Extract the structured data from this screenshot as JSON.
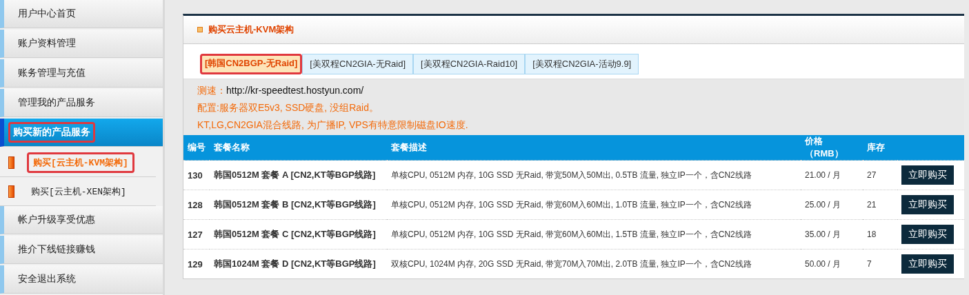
{
  "sidebar": {
    "items": [
      {
        "label": "用户中心首页",
        "selected": false
      },
      {
        "label": "账户资料管理",
        "selected": false
      },
      {
        "label": "账务管理与充值",
        "selected": false
      },
      {
        "label": "管理我的产品服务",
        "selected": false
      },
      {
        "label": "购买新的产品服务",
        "selected": true,
        "children": [
          {
            "label": "购买[云主机-KVM架构]",
            "selected": true
          },
          {
            "label": "购买[云主机-XEN架构]",
            "selected": false
          }
        ]
      },
      {
        "label": "帐户升级享受优惠",
        "selected": false
      },
      {
        "label": "推介下线链接赚钱",
        "selected": false
      },
      {
        "label": "安全退出系统",
        "selected": false
      }
    ]
  },
  "panel": {
    "title": "购买云主机-KVM架构",
    "tabs": [
      {
        "label": "[韩国CN2BGP-无Raid]",
        "selected": true
      },
      {
        "label": "[美双程CN2GIA-无Raid]",
        "selected": false
      },
      {
        "label": "[美双程CN2GIA-Raid10]",
        "selected": false
      },
      {
        "label": "[美双程CN2GIA-活动9.9]",
        "selected": false
      }
    ],
    "speedtest_label": "测速：",
    "speedtest_url": "http://kr-speedtest.hostyun.com/",
    "notes": [
      "配置:服务器双E5v3, SSD硬盘, 没组Raid。",
      "KT,LG,CN2GIA混合线路, 为广播IP, VPS有特意限制磁盘IO速度."
    ],
    "table": {
      "columns": [
        "编号",
        "套餐名称",
        "套餐描述",
        "价格（RMB）",
        "库存"
      ],
      "rows": [
        {
          "id": "130",
          "name": "韩国0512M 套餐 A [CN2,KT等BGP线路]",
          "description": "单核CPU, 0512M 内存, 10G SSD 无Raid, 带宽50M入50M出, 0.5TB 流量, 独立IP一个，含CN2线路",
          "price": "21.00 / 月",
          "stock": "27",
          "action": "立即购买"
        },
        {
          "id": "128",
          "name": "韩国0512M 套餐 B [CN2,KT等BGP线路]",
          "description": "单核CPU, 0512M 内存, 10G SSD 无Raid, 带宽60M入60M出, 1.0TB 流量, 独立IP一个，含CN2线路",
          "price": "25.00 / 月",
          "stock": "21",
          "action": "立即购买"
        },
        {
          "id": "127",
          "name": "韩国0512M 套餐 C [CN2,KT等BGP线路]",
          "description": "单核CPU, 0512M 内存, 10G SSD 无Raid, 带宽60M入60M出, 1.5TB 流量, 独立IP一个，含CN2线路",
          "price": "35.00 / 月",
          "stock": "18",
          "action": "立即购买"
        },
        {
          "id": "129",
          "name": "韩国1024M 套餐 D [CN2,KT等BGP线路]",
          "description": "双核CPU, 1024M 内存, 20G SSD 无Raid, 带宽70M入70M出, 2.0TB 流量, 独立IP一个，含CN2线路",
          "price": "50.00 / 月",
          "stock": "7",
          "action": "立即购买"
        }
      ]
    }
  }
}
